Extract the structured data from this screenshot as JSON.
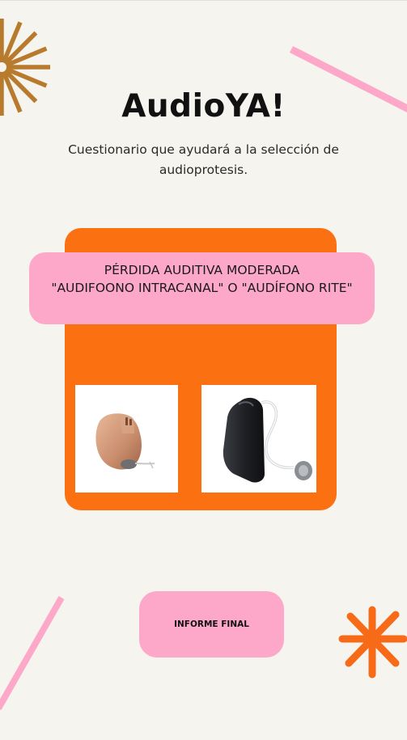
{
  "app": {
    "title": "AudioYA!",
    "subtitle": "Cuestionario que ayudará a la selección de audioprotesis."
  },
  "result": {
    "line1": "PÉRDIDA AUDITIVA MODERADA",
    "line2": "\"AUDIFOONO INTRACANAL\" O \"AUDÍFONO RITE\""
  },
  "images": [
    {
      "name": "hearing-aid-intracanal-image"
    },
    {
      "name": "hearing-aid-rite-image"
    }
  ],
  "actions": {
    "final_report_label": "INFORME FINAL"
  },
  "colors": {
    "background": "#f6f4ee",
    "card_orange": "#fb7010",
    "accent_pink": "#fda8c9",
    "sunburst_brown": "#b87b2e",
    "star_orange": "#f66a18"
  }
}
